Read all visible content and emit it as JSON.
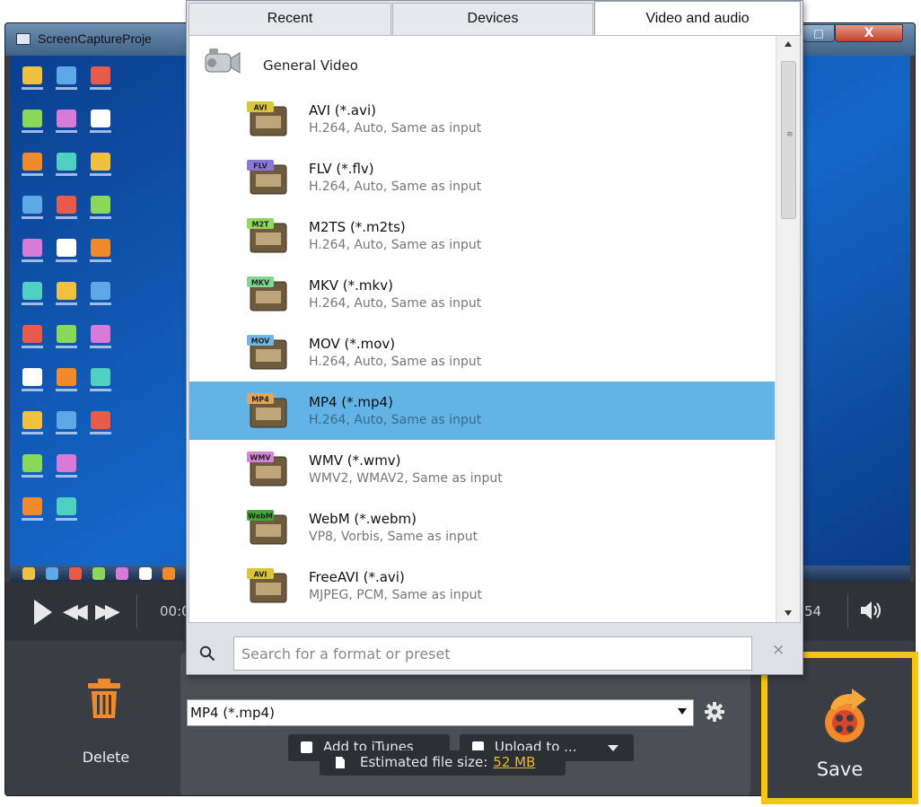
{
  "window": {
    "title": "ScreenCaptureProje",
    "maximize_glyph": "□",
    "close_glyph": "X"
  },
  "player": {
    "time_left": "00:0",
    "time_right": "54",
    "rewind_glyph": "◀◀",
    "forward_glyph": "▶▶"
  },
  "delete": {
    "label": "Delete"
  },
  "export": {
    "selected_format": "MP4 (*.mp4)",
    "add_to_itunes": "Add to iTunes",
    "upload_to": "Upload to ...",
    "estimated_size_label": "Estimated file size:",
    "estimated_size_value": "52 MB"
  },
  "save": {
    "label": "Save"
  },
  "format_popup": {
    "tabs": [
      "Recent",
      "Devices",
      "Video and audio"
    ],
    "active_tab": "Video and audio",
    "group": "General Video",
    "items": [
      {
        "name": "AVI (*.avi)",
        "desc": "H.264, Auto, Same as input",
        "badge": "AVI",
        "badge_color": "#d9c43a"
      },
      {
        "name": "FLV (*.flv)",
        "desc": "H.264, Auto, Same as input",
        "badge": "FLV",
        "badge_color": "#8a78d8"
      },
      {
        "name": "M2TS (*.m2ts)",
        "desc": "H.264, Auto, Same as input",
        "badge": "M2T",
        "badge_color": "#8fd85a"
      },
      {
        "name": "MKV (*.mkv)",
        "desc": "H.264, Auto, Same as input",
        "badge": "MKV",
        "badge_color": "#7fd890"
      },
      {
        "name": "MOV (*.mov)",
        "desc": "H.264, Auto, Same as input",
        "badge": "MOV",
        "badge_color": "#6fb8e8"
      },
      {
        "name": "MP4 (*.mp4)",
        "desc": "H.264, Auto, Same as input",
        "badge": "MP4",
        "badge_color": "#e2a45a",
        "selected": true
      },
      {
        "name": "WMV (*.wmv)",
        "desc": "WMV2, WMAV2, Same as input",
        "badge": "WMV",
        "badge_color": "#d684d8"
      },
      {
        "name": "WebM (*.webm)",
        "desc": "VP8, Vorbis, Same as input",
        "badge": "WebM",
        "badge_color": "#44a73a"
      },
      {
        "name": "FreeAVI (*.avi)",
        "desc": "MJPEG, PCM, Same as input",
        "badge": "AVI",
        "badge_color": "#d9c43a"
      }
    ],
    "search_placeholder": "Search for a format or preset",
    "clear_glyph": "×"
  },
  "colors": {
    "highlight": "#f4c518",
    "selected_row": "#62b3e6",
    "accent_orange": "#f08a2a",
    "link_yellow": "#e7b737"
  },
  "icons": [
    "camera-icon",
    "film-format-icon",
    "search-icon",
    "trash-icon",
    "gear-icon",
    "volume-icon",
    "save-film-icon",
    "file-icon"
  ]
}
